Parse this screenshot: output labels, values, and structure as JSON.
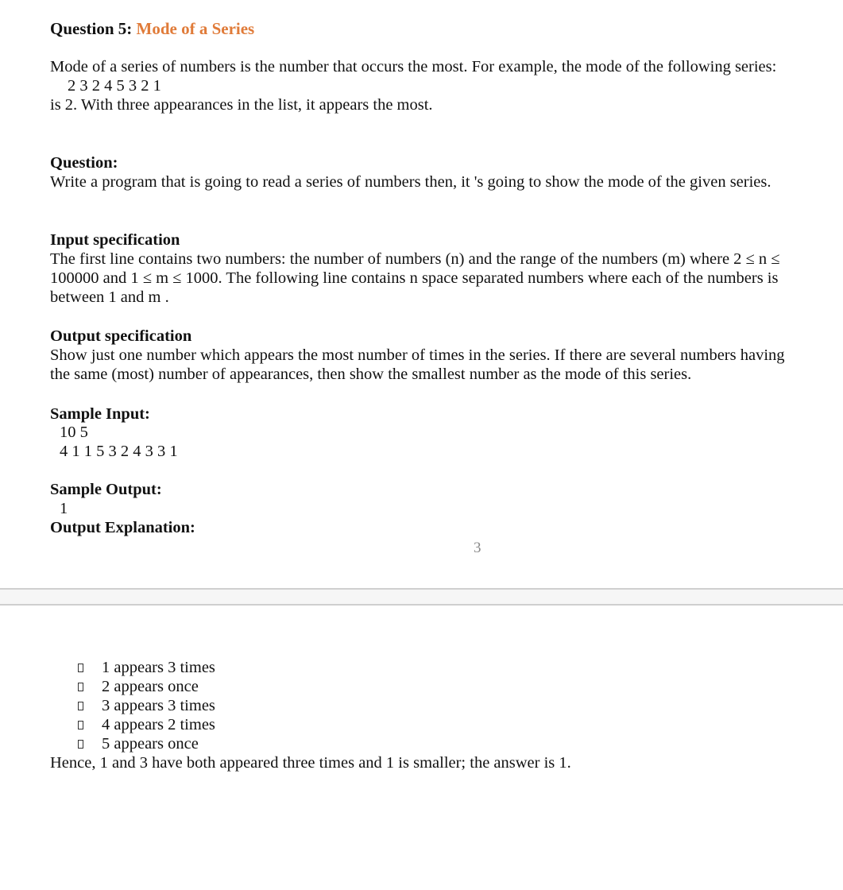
{
  "title": {
    "prefix": "Question 5:",
    "name": "Mode of a Series"
  },
  "intro": {
    "text": "Mode of a series of numbers is the number that occurs the most. For example, the mode of the following series:",
    "example_series": "2 3 2 4 5 3 2 1",
    "conclusion": "is 2. With three appearances in the list, it appears the most."
  },
  "question": {
    "heading": "Question:",
    "text": "Write a program that is going to read a series of numbers then, it 's going to show the mode of the given series."
  },
  "input_spec": {
    "heading": "Input specification",
    "text": "The first line contains two numbers: the number of numbers (n) and the range of the numbers (m) where 2 ≤ n ≤ 100000 and 1 ≤ m ≤ 1000. The following line contains n space separated numbers where each of the numbers is between 1 and m ."
  },
  "output_spec": {
    "heading": "Output specification",
    "text": "Show just one number which appears the most number of times in the series. If there are several numbers having the same (most) number of appearances, then show the smallest number as the mode of this series."
  },
  "sample_input": {
    "heading": "Sample Input:",
    "lines": [
      "10 5",
      "4 1 1 5 3 2 4 3 3 1"
    ]
  },
  "sample_output": {
    "heading": "Sample Output:",
    "value": "1"
  },
  "explanation": {
    "heading": "Output Explanation:",
    "items": [
      "1 appears 3 times",
      "2 appears once",
      "3 appears 3 times",
      "4 appears 2 times",
      "5 appears once"
    ],
    "conclusion": "Hence, 1 and 3 have both appeared three times and 1 is smaller; the answer is 1."
  },
  "page_number": "3",
  "colors": {
    "accent": "#e07b39",
    "page_break_bg": "#f6f6f6",
    "page_break_border": "#cfcfcf"
  }
}
